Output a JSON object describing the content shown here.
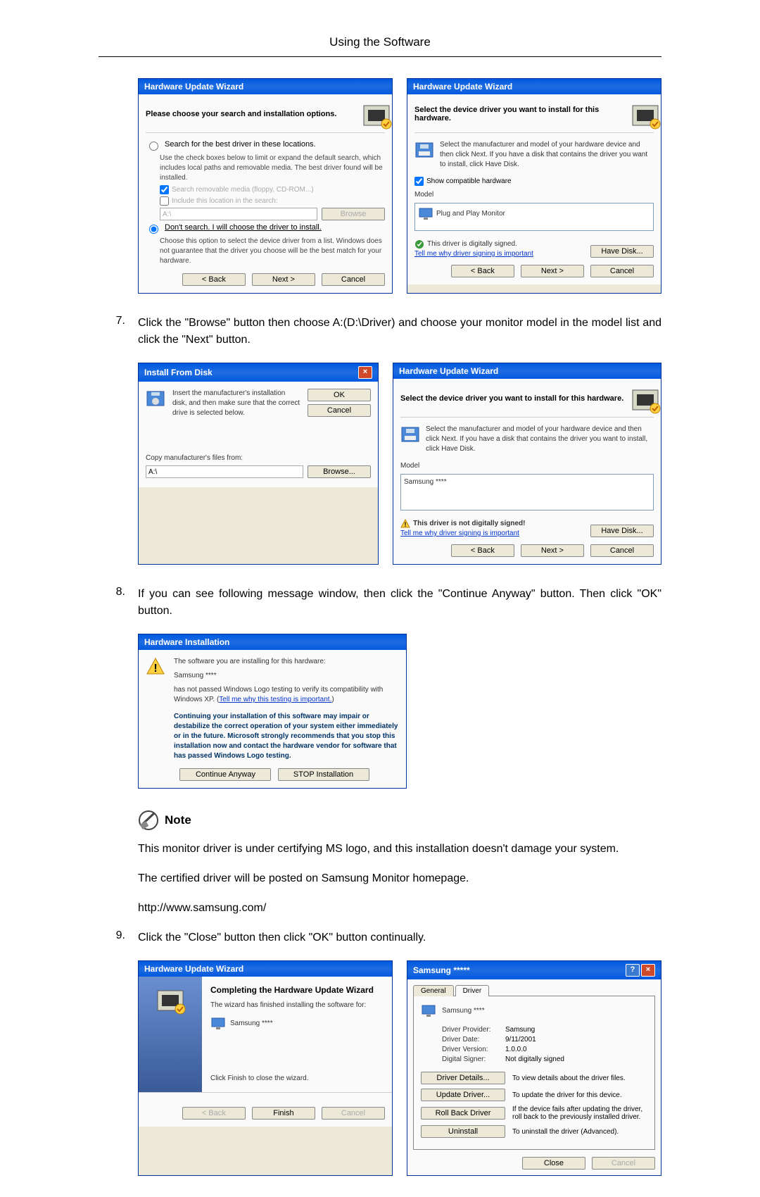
{
  "page_header": "Using the Software",
  "steps": {
    "s7": {
      "num": "7.",
      "text": "Click the \"Browse\" button then choose A:(D:\\Driver) and choose your monitor model in the model list and click the \"Next\" button."
    },
    "s8": {
      "num": "8.",
      "text": "If you can see following message window, then click the \"Continue Anyway\" button. Then click \"OK\" button."
    },
    "s9": {
      "num": "9.",
      "text": "Click the \"Close\" button then click \"OK\" button continually."
    }
  },
  "note": {
    "label": "Note",
    "p1": "This monitor driver is under certifying MS logo, and this installation doesn't damage your system.",
    "p2": "The certified driver will be posted on Samsung Monitor homepage.",
    "url": "http://www.samsung.com/"
  },
  "dlg_search": {
    "title": "Hardware Update Wizard",
    "heading": "Please choose your search and installation options.",
    "opt1_label": "Search for the best driver in these locations.",
    "opt1_sub": "Use the check boxes below to limit or expand the default search, which includes local paths and removable media. The best driver found will be installed.",
    "chk1": "Search removable media (floppy, CD-ROM...)",
    "chk2": "Include this location in the search:",
    "path": "A:\\",
    "browse_btn": "Browse",
    "opt2_label": "Don't search. I will choose the driver to install.",
    "opt2_sub": "Choose this option to select the device driver from a list. Windows does not guarantee that the driver you choose will be the best match for your hardware.",
    "back": "< Back",
    "next": "Next >",
    "cancel": "Cancel"
  },
  "dlg_select1": {
    "title": "Hardware Update Wizard",
    "heading": "Select the device driver you want to install for this hardware.",
    "instr": "Select the manufacturer and model of your hardware device and then click Next. If you have a disk that contains the driver you want to install, click Have Disk.",
    "show_compat": "Show compatible hardware",
    "model_hdr": "Model",
    "model_item": "Plug and Play Monitor",
    "signed": "This driver is digitally signed.",
    "tell_me": "Tell me why driver signing is important",
    "have_disk": "Have Disk...",
    "back": "< Back",
    "next": "Next >",
    "cancel": "Cancel"
  },
  "dlg_install_disk": {
    "title": "Install From Disk",
    "instr": "Insert the manufacturer's installation disk, and then make sure that the correct drive is selected below.",
    "ok": "OK",
    "cancel": "Cancel",
    "copy_from": "Copy manufacturer's files from:",
    "path": "A:\\",
    "browse": "Browse..."
  },
  "dlg_select2": {
    "title": "Hardware Update Wizard",
    "heading": "Select the device driver you want to install for this hardware.",
    "instr": "Select the manufacturer and model of your hardware device and then click Next. If you have a disk that contains the driver you want to install, click Have Disk.",
    "model_hdr": "Model",
    "model_item": "Samsung ****",
    "not_signed": "This driver is not digitally signed!",
    "tell_me": "Tell me why driver signing is important",
    "have_disk": "Have Disk...",
    "back": "< Back",
    "next": "Next >",
    "cancel": "Cancel"
  },
  "dlg_hwinstall": {
    "title": "Hardware Installation",
    "l1": "The software you are installing for this hardware:",
    "l2": "Samsung ****",
    "l3": "has not passed Windows Logo testing to verify its compatibility with Windows XP. (",
    "l3_link": "Tell me why this testing is important.",
    "l3_close": ")",
    "warn": "Continuing your installation of this software may impair or destabilize the correct operation of your system either immediately or in the future. Microsoft strongly recommends that you stop this installation now and contact the hardware vendor for software that has passed Windows Logo testing.",
    "cont": "Continue Anyway",
    "stop": "STOP Installation"
  },
  "dlg_complete": {
    "title": "Hardware Update Wizard",
    "heading": "Completing the Hardware Update Wizard",
    "sub": "The wizard has finished installing the software for:",
    "item": "Samsung ****",
    "finish_hint": "Click Finish to close the wizard.",
    "back": "< Back",
    "finish": "Finish",
    "cancel": "Cancel"
  },
  "dlg_props": {
    "title": "Samsung *****",
    "tab_general": "General",
    "tab_driver": "Driver",
    "name": "Samsung ****",
    "k_provider": "Driver Provider:",
    "v_provider": "Samsung",
    "k_date": "Driver Date:",
    "v_date": "9/11/2001",
    "k_version": "Driver Version:",
    "v_version": "1.0.0.0",
    "k_signer": "Digital Signer:",
    "v_signer": "Not digitally signed",
    "btn_details": "Driver Details...",
    "txt_details": "To view details about the driver files.",
    "btn_update": "Update Driver...",
    "txt_update": "To update the driver for this device.",
    "btn_rollback": "Roll Back Driver",
    "txt_rollback": "If the device fails after updating the driver, roll back to the previously installed driver.",
    "btn_uninstall": "Uninstall",
    "txt_uninstall": "To uninstall the driver (Advanced).",
    "close": "Close",
    "cancel": "Cancel"
  }
}
